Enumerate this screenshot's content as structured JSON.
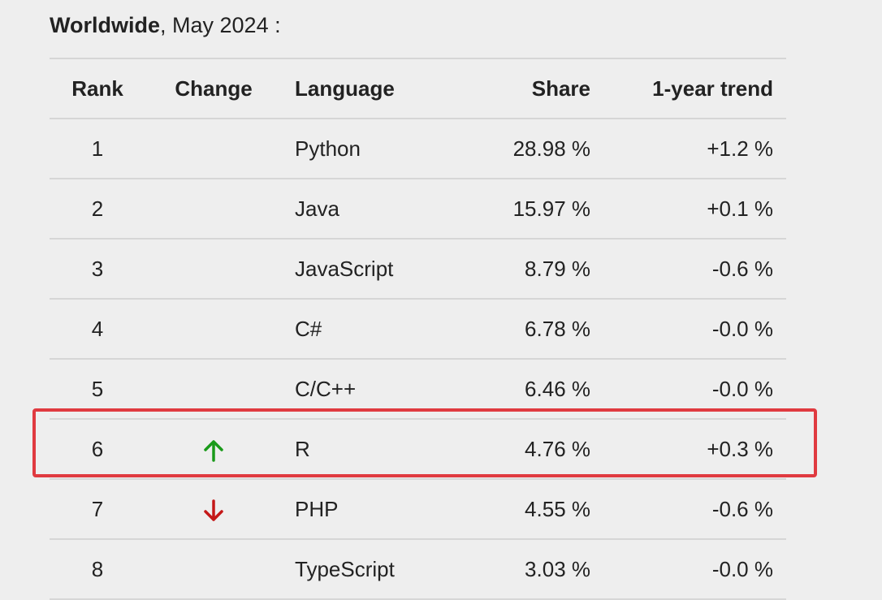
{
  "caption": {
    "bold": "Worldwide",
    "rest": ", May 2024 :"
  },
  "columns": {
    "rank": "Rank",
    "change": "Change",
    "language": "Language",
    "share": "Share",
    "trend": "1-year trend"
  },
  "rows": [
    {
      "rank": "1",
      "change": "",
      "language": "Python",
      "share": "28.98 %",
      "trend": "+1.2 %"
    },
    {
      "rank": "2",
      "change": "",
      "language": "Java",
      "share": "15.97 %",
      "trend": "+0.1 %"
    },
    {
      "rank": "3",
      "change": "",
      "language": "JavaScript",
      "share": "8.79 %",
      "trend": "-0.6 %"
    },
    {
      "rank": "4",
      "change": "",
      "language": "C#",
      "share": "6.78 %",
      "trend": "-0.0 %"
    },
    {
      "rank": "5",
      "change": "",
      "language": "C/C++",
      "share": "6.46 %",
      "trend": "-0.0 %"
    },
    {
      "rank": "6",
      "change": "up",
      "language": "R",
      "share": "4.76 %",
      "trend": "+0.3 %"
    },
    {
      "rank": "7",
      "change": "down",
      "language": "PHP",
      "share": "4.55 %",
      "trend": "-0.6 %"
    },
    {
      "rank": "8",
      "change": "",
      "language": "TypeScript",
      "share": "3.03 %",
      "trend": "-0.0 %"
    }
  ],
  "icons": {
    "up": "arrow-up-icon",
    "down": "arrow-down-icon"
  },
  "colors": {
    "up": "#1a9a1a",
    "down": "#c41818",
    "highlight": "#e03a40"
  }
}
